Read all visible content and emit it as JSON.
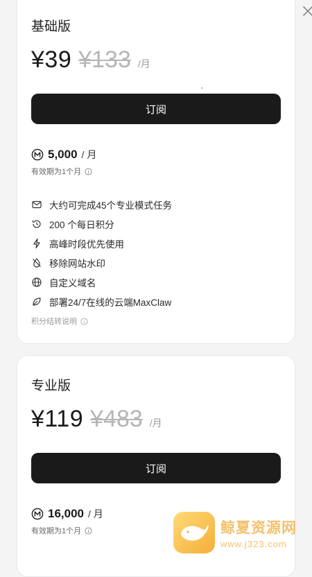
{
  "close_icon": "close-icon",
  "plans": [
    {
      "name": "基础版",
      "price": "¥39",
      "original_price": "¥133",
      "unit": "/月",
      "subscribe_label": "订阅",
      "credits": "5,000",
      "credits_unit": "/ 月",
      "validity": "有效期为1个月",
      "features": [
        {
          "icon": "mail-icon",
          "text": "大约可完成45个专业模式任务"
        },
        {
          "icon": "history-icon",
          "text": "200 个每日积分"
        },
        {
          "icon": "lightning-icon",
          "text": "高峰时段优先使用"
        },
        {
          "icon": "no-drop-icon",
          "text": "移除网站水印"
        },
        {
          "icon": "globe-icon",
          "text": "自定义域名"
        },
        {
          "icon": "leaf-icon",
          "text": "部署24/7在线的云端MaxClaw"
        }
      ],
      "note": "积分结转说明"
    },
    {
      "name": "专业版",
      "price": "¥119",
      "original_price": "¥483",
      "unit": "/月",
      "subscribe_label": "订阅",
      "credits": "16,000",
      "credits_unit": "/ 月",
      "validity": "有效期为1个月"
    }
  ],
  "watermark": {
    "title": "鲸夏资源网",
    "url": "www.j323.com"
  },
  "colors": {
    "button_bg": "#1a1a1a",
    "strike_price": "#b5b5b5",
    "watermark": "#f2a52c"
  }
}
